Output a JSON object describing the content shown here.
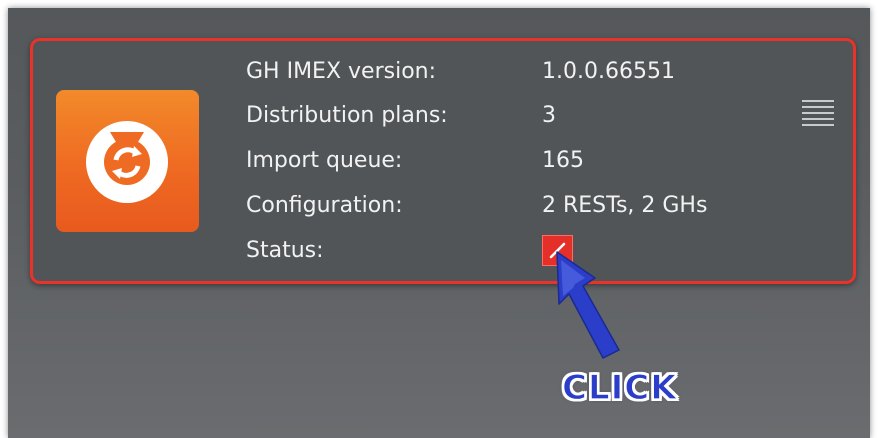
{
  "card": {
    "rows": [
      {
        "label": "GH IMEX version:",
        "value": "1.0.0.66551"
      },
      {
        "label": "Distribution plans:",
        "value": "3"
      },
      {
        "label": "Import queue:",
        "value": "165"
      },
      {
        "label": "Configuration:",
        "value": "2 RESTs, 2 GHs"
      },
      {
        "label": "Status:",
        "value": ""
      }
    ],
    "logo_icon": "sync-refresh-icon",
    "menu_icon": "hamburger-menu-icon",
    "status_icon": "status-edit-icon"
  },
  "annotation": {
    "text": "CLICK",
    "pointer_icon": "hand-pointer-icon"
  },
  "colors": {
    "panel": "#5a5d60",
    "card": "#515558",
    "highlight_border": "#e8322a",
    "logo_orange": "#ef6a22",
    "status_red": "#e5302a",
    "pointer_blue": "#2a3ec9"
  }
}
